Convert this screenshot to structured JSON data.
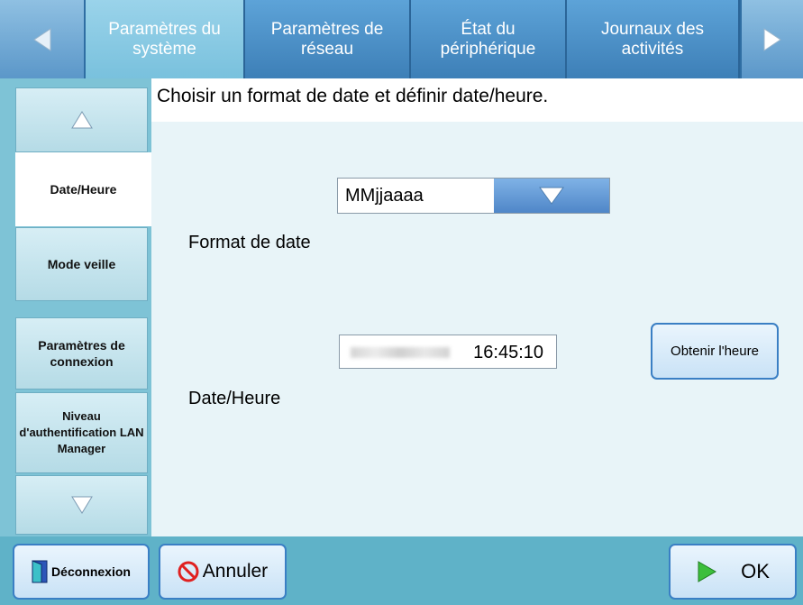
{
  "tabs": [
    {
      "label": "Paramètres du système",
      "active": true
    },
    {
      "label": "Paramètres de réseau",
      "active": false
    },
    {
      "label": "État du périphérique",
      "active": false
    },
    {
      "label": "Journaux des activités",
      "active": false
    }
  ],
  "sidebar": {
    "items": [
      {
        "label": "Date/Heure",
        "selected": true
      },
      {
        "label": "Mode veille",
        "selected": false
      },
      {
        "label": "Paramètres de connexion",
        "selected": false
      },
      {
        "label": "Niveau d'authentification LAN Manager",
        "selected": false
      }
    ]
  },
  "main": {
    "instruction": "Choisir un format de date et définir date/heure.",
    "date_format_label": "Format de date",
    "date_format_value": "MMjjaaaa",
    "datetime_label": "Date/Heure",
    "time_value": "16:45:10",
    "get_time_label": "Obtenir l'heure"
  },
  "bottom": {
    "logout_label": "Déconnexion",
    "cancel_label": "Annuler",
    "ok_label": "OK"
  },
  "colors": {
    "tab_bar": "#4a8ec4",
    "active_tab": "#79c1dd",
    "sidebar": "#7ec3d6",
    "button_border": "#3a7fc4",
    "bottom_bar": "#5fb2c8",
    "cancel_icon": "#e02020",
    "ok_icon": "#3cbf3c"
  },
  "icons": {
    "nav_left": "triangle-left-icon",
    "nav_right": "triangle-right-icon",
    "scroll_up": "triangle-up-icon",
    "scroll_down": "triangle-down-icon",
    "dropdown": "triangle-down-icon",
    "logout": "door-icon",
    "cancel": "prohibited-icon",
    "ok": "play-arrow-icon"
  }
}
